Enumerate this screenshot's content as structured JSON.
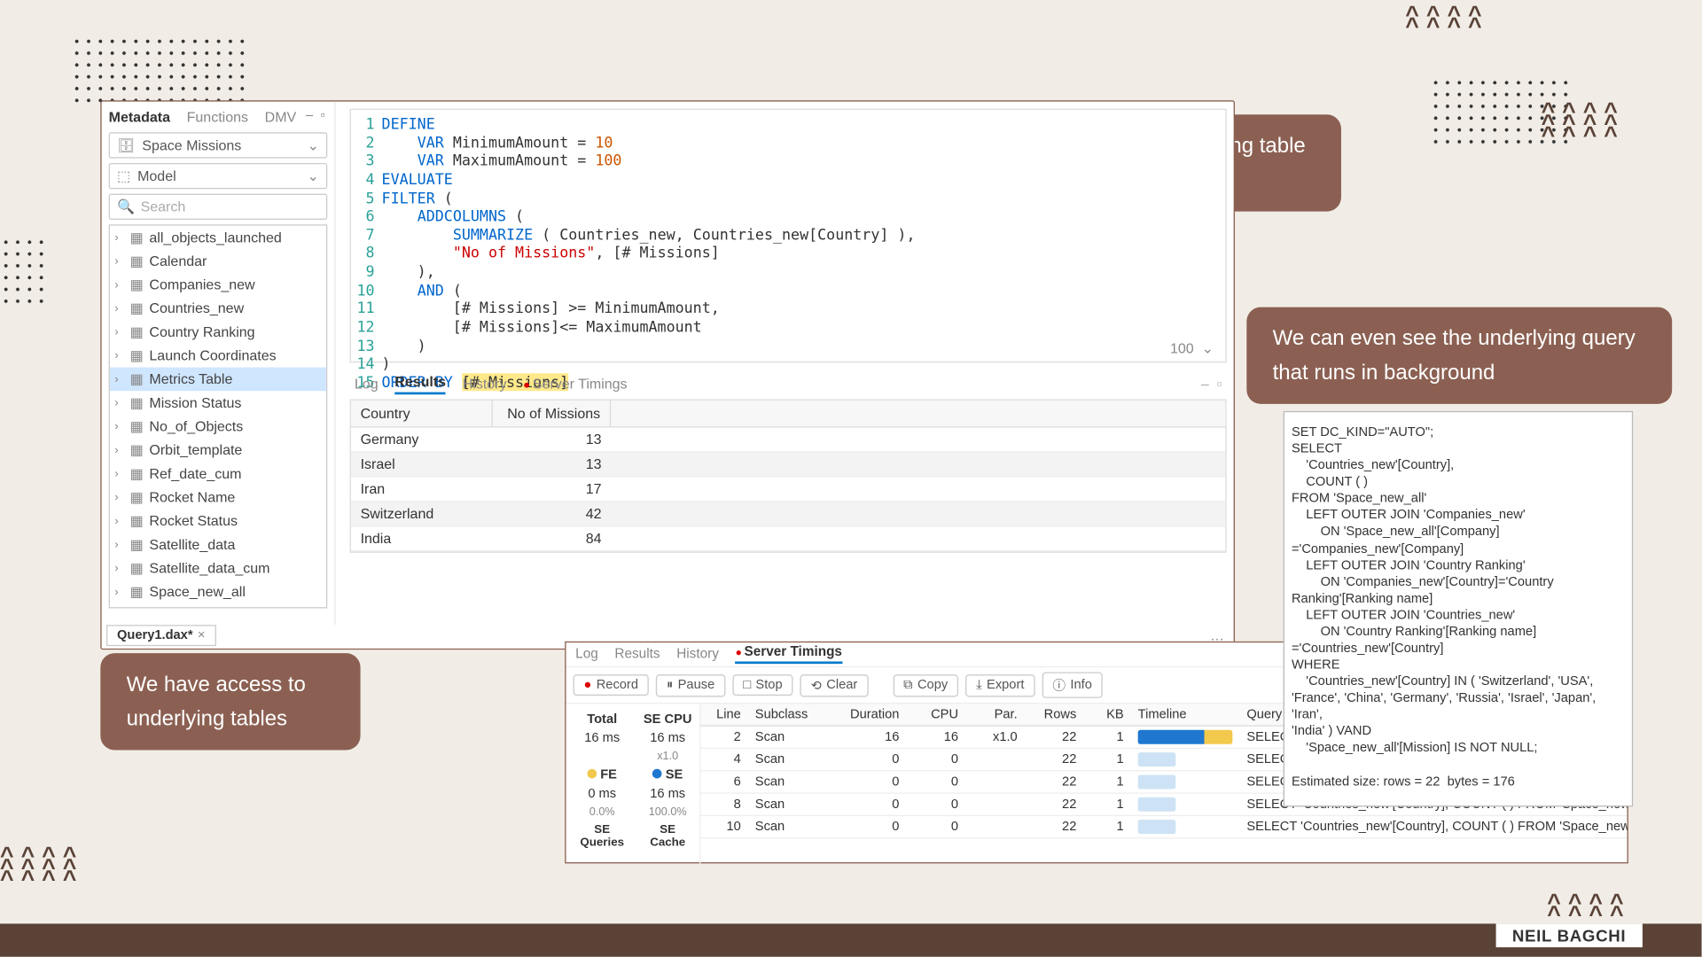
{
  "author": "NEIL BAGCHI",
  "annotations": {
    "a1": "We can query the underlying table using DAX, SQL etc",
    "a2": "We can even see the underlying query that runs in background",
    "a3": "We have access to underlying tables"
  },
  "metadata_panel": {
    "tabs": [
      "Metadata",
      "Functions",
      "DMV"
    ],
    "db": "Space Missions",
    "model": "Model",
    "search_placeholder": "Search",
    "tree": [
      "all_objects_launched",
      "Calendar",
      "Companies_new",
      "Countries_new",
      "Country Ranking",
      "Launch Coordinates",
      "Metrics Table",
      "Mission Status",
      "No_of_Objects",
      "Orbit_template",
      "Ref_date_cum",
      "Rocket Name",
      "Rocket Status",
      "Satellite_data",
      "Satellite_data_cum",
      "Space_new_all"
    ],
    "selected": "Metrics Table"
  },
  "editor": {
    "limit": "100",
    "lines": [
      {
        "n": 1,
        "seg": [
          {
            "t": "DEFINE",
            "c": "kw"
          }
        ]
      },
      {
        "n": 2,
        "seg": [
          {
            "t": "    "
          },
          {
            "t": "VAR",
            "c": "kw"
          },
          {
            "t": " MinimumAmount = "
          },
          {
            "t": "10",
            "c": "num-lit"
          }
        ]
      },
      {
        "n": 3,
        "seg": [
          {
            "t": "    "
          },
          {
            "t": "VAR",
            "c": "kw"
          },
          {
            "t": " MaximumAmount = "
          },
          {
            "t": "100",
            "c": "num-lit"
          }
        ]
      },
      {
        "n": 4,
        "seg": [
          {
            "t": "EVALUATE",
            "c": "kw"
          }
        ]
      },
      {
        "n": 5,
        "seg": [
          {
            "t": "FILTER",
            "c": "kw"
          },
          {
            "t": " ("
          }
        ]
      },
      {
        "n": 6,
        "seg": [
          {
            "t": "    "
          },
          {
            "t": "ADDCOLUMNS",
            "c": "kw"
          },
          {
            "t": " ("
          }
        ]
      },
      {
        "n": 7,
        "seg": [
          {
            "t": "        "
          },
          {
            "t": "SUMMARIZE",
            "c": "kw"
          },
          {
            "t": " ( Countries_new, Countries_new[Country] ),"
          }
        ]
      },
      {
        "n": 8,
        "seg": [
          {
            "t": "        "
          },
          {
            "t": "\"No of Missions\"",
            "c": "str"
          },
          {
            "t": ", [# Missions]"
          }
        ]
      },
      {
        "n": 9,
        "seg": [
          {
            "t": "    ),"
          }
        ]
      },
      {
        "n": 10,
        "seg": [
          {
            "t": "    "
          },
          {
            "t": "AND",
            "c": "kw"
          },
          {
            "t": " ("
          }
        ]
      },
      {
        "n": 11,
        "seg": [
          {
            "t": "        [# Missions] >= MinimumAmount,"
          }
        ]
      },
      {
        "n": 12,
        "seg": [
          {
            "t": "        [# Missions]<= MaximumAmount"
          }
        ]
      },
      {
        "n": 13,
        "seg": [
          {
            "t": "    )"
          }
        ]
      },
      {
        "n": 14,
        "seg": [
          {
            "t": ")"
          }
        ]
      },
      {
        "n": 15,
        "seg": [
          {
            "t": "ORDER BY",
            "c": "kw"
          },
          {
            "t": " "
          },
          {
            "t": "[# Missions]",
            "c": "hl"
          }
        ]
      }
    ]
  },
  "results": {
    "tabs": [
      "Log",
      "Results",
      "History",
      "Server Timings"
    ],
    "columns": [
      "Country",
      "No of Missions"
    ],
    "rows": [
      {
        "country": "Germany",
        "n": "13"
      },
      {
        "country": "Israel",
        "n": "13"
      },
      {
        "country": "Iran",
        "n": "17"
      },
      {
        "country": "Switzerland",
        "n": "42"
      },
      {
        "country": "India",
        "n": "84"
      }
    ]
  },
  "file_tab": "Query1.dax*",
  "timings": {
    "tabs": [
      "Log",
      "Results",
      "History",
      "Server Timings"
    ],
    "toolbar": [
      "Record",
      "Pause",
      "Stop",
      "Clear",
      "Copy",
      "Export",
      "Info"
    ],
    "stats": {
      "total_label": "Total",
      "total": "16 ms",
      "secpu_label": "SE CPU",
      "secpu": "16 ms",
      "secpu_x": "x1.0",
      "fe_label": "FE",
      "fe": "0 ms",
      "fe_pct": "0.0%",
      "se_label": "SE",
      "se": "16 ms",
      "se_pct": "100.0%",
      "seq_label": "SE Queries",
      "sec_label": "SE Cache"
    },
    "columns": [
      "Line",
      "Subclass",
      "Duration",
      "CPU",
      "Par.",
      "Rows",
      "KB",
      "Timeline",
      "Query"
    ],
    "grid": [
      {
        "line": "2",
        "sub": "Scan",
        "dur": "16",
        "cpu": "16",
        "par": "x1.0",
        "rows": "22",
        "kb": "1",
        "full": true,
        "q": "SELECT 'Countries_new'[Country], COUNT ( ) FROM 'Space_new_all' LEFT O"
      },
      {
        "line": "4",
        "sub": "Scan",
        "dur": "0",
        "cpu": "0",
        "par": "",
        "rows": "22",
        "kb": "1",
        "q": "SELECT 'Countries_new'[Country], COUNT ( ) FROM 'Space_new_all' LEFT O"
      },
      {
        "line": "6",
        "sub": "Scan",
        "dur": "0",
        "cpu": "0",
        "par": "",
        "rows": "22",
        "kb": "1",
        "q": "SELECT 'Countries_new'[Country], COUNT ( ) FROM 'Space_new_all' LEFT O"
      },
      {
        "line": "8",
        "sub": "Scan",
        "dur": "0",
        "cpu": "0",
        "par": "",
        "rows": "22",
        "kb": "1",
        "q": "SELECT 'Countries_new'[Country], COUNT ( ) FROM 'Space_new_all' LEFT O"
      },
      {
        "line": "10",
        "sub": "Scan",
        "dur": "0",
        "cpu": "0",
        "par": "",
        "rows": "22",
        "kb": "1",
        "q": "SELECT 'Countries_new'[Country], COUNT ( ) FROM 'Space_new_all' LEFT O"
      }
    ]
  },
  "inspector_text": "SET DC_KIND=\"AUTO\";\nSELECT\n    'Countries_new'[Country],\n    COUNT ( )\nFROM 'Space_new_all'\n    LEFT OUTER JOIN 'Companies_new'\n        ON 'Space_new_all'[Company]\n='Companies_new'[Company]\n    LEFT OUTER JOIN 'Country Ranking'\n        ON 'Companies_new'[Country]='Country\nRanking'[Ranking name]\n    LEFT OUTER JOIN 'Countries_new'\n        ON 'Country Ranking'[Ranking name]\n='Countries_new'[Country]\nWHERE\n    'Countries_new'[Country] IN ( 'Switzerland', 'USA',\n'France', 'China', 'Germany', 'Russia', 'Israel', 'Japan', 'Iran',\n'India' ) VAND\n    'Space_new_all'[Mission] IS NOT NULL;\n\nEstimated size: rows = 22  bytes = 176"
}
